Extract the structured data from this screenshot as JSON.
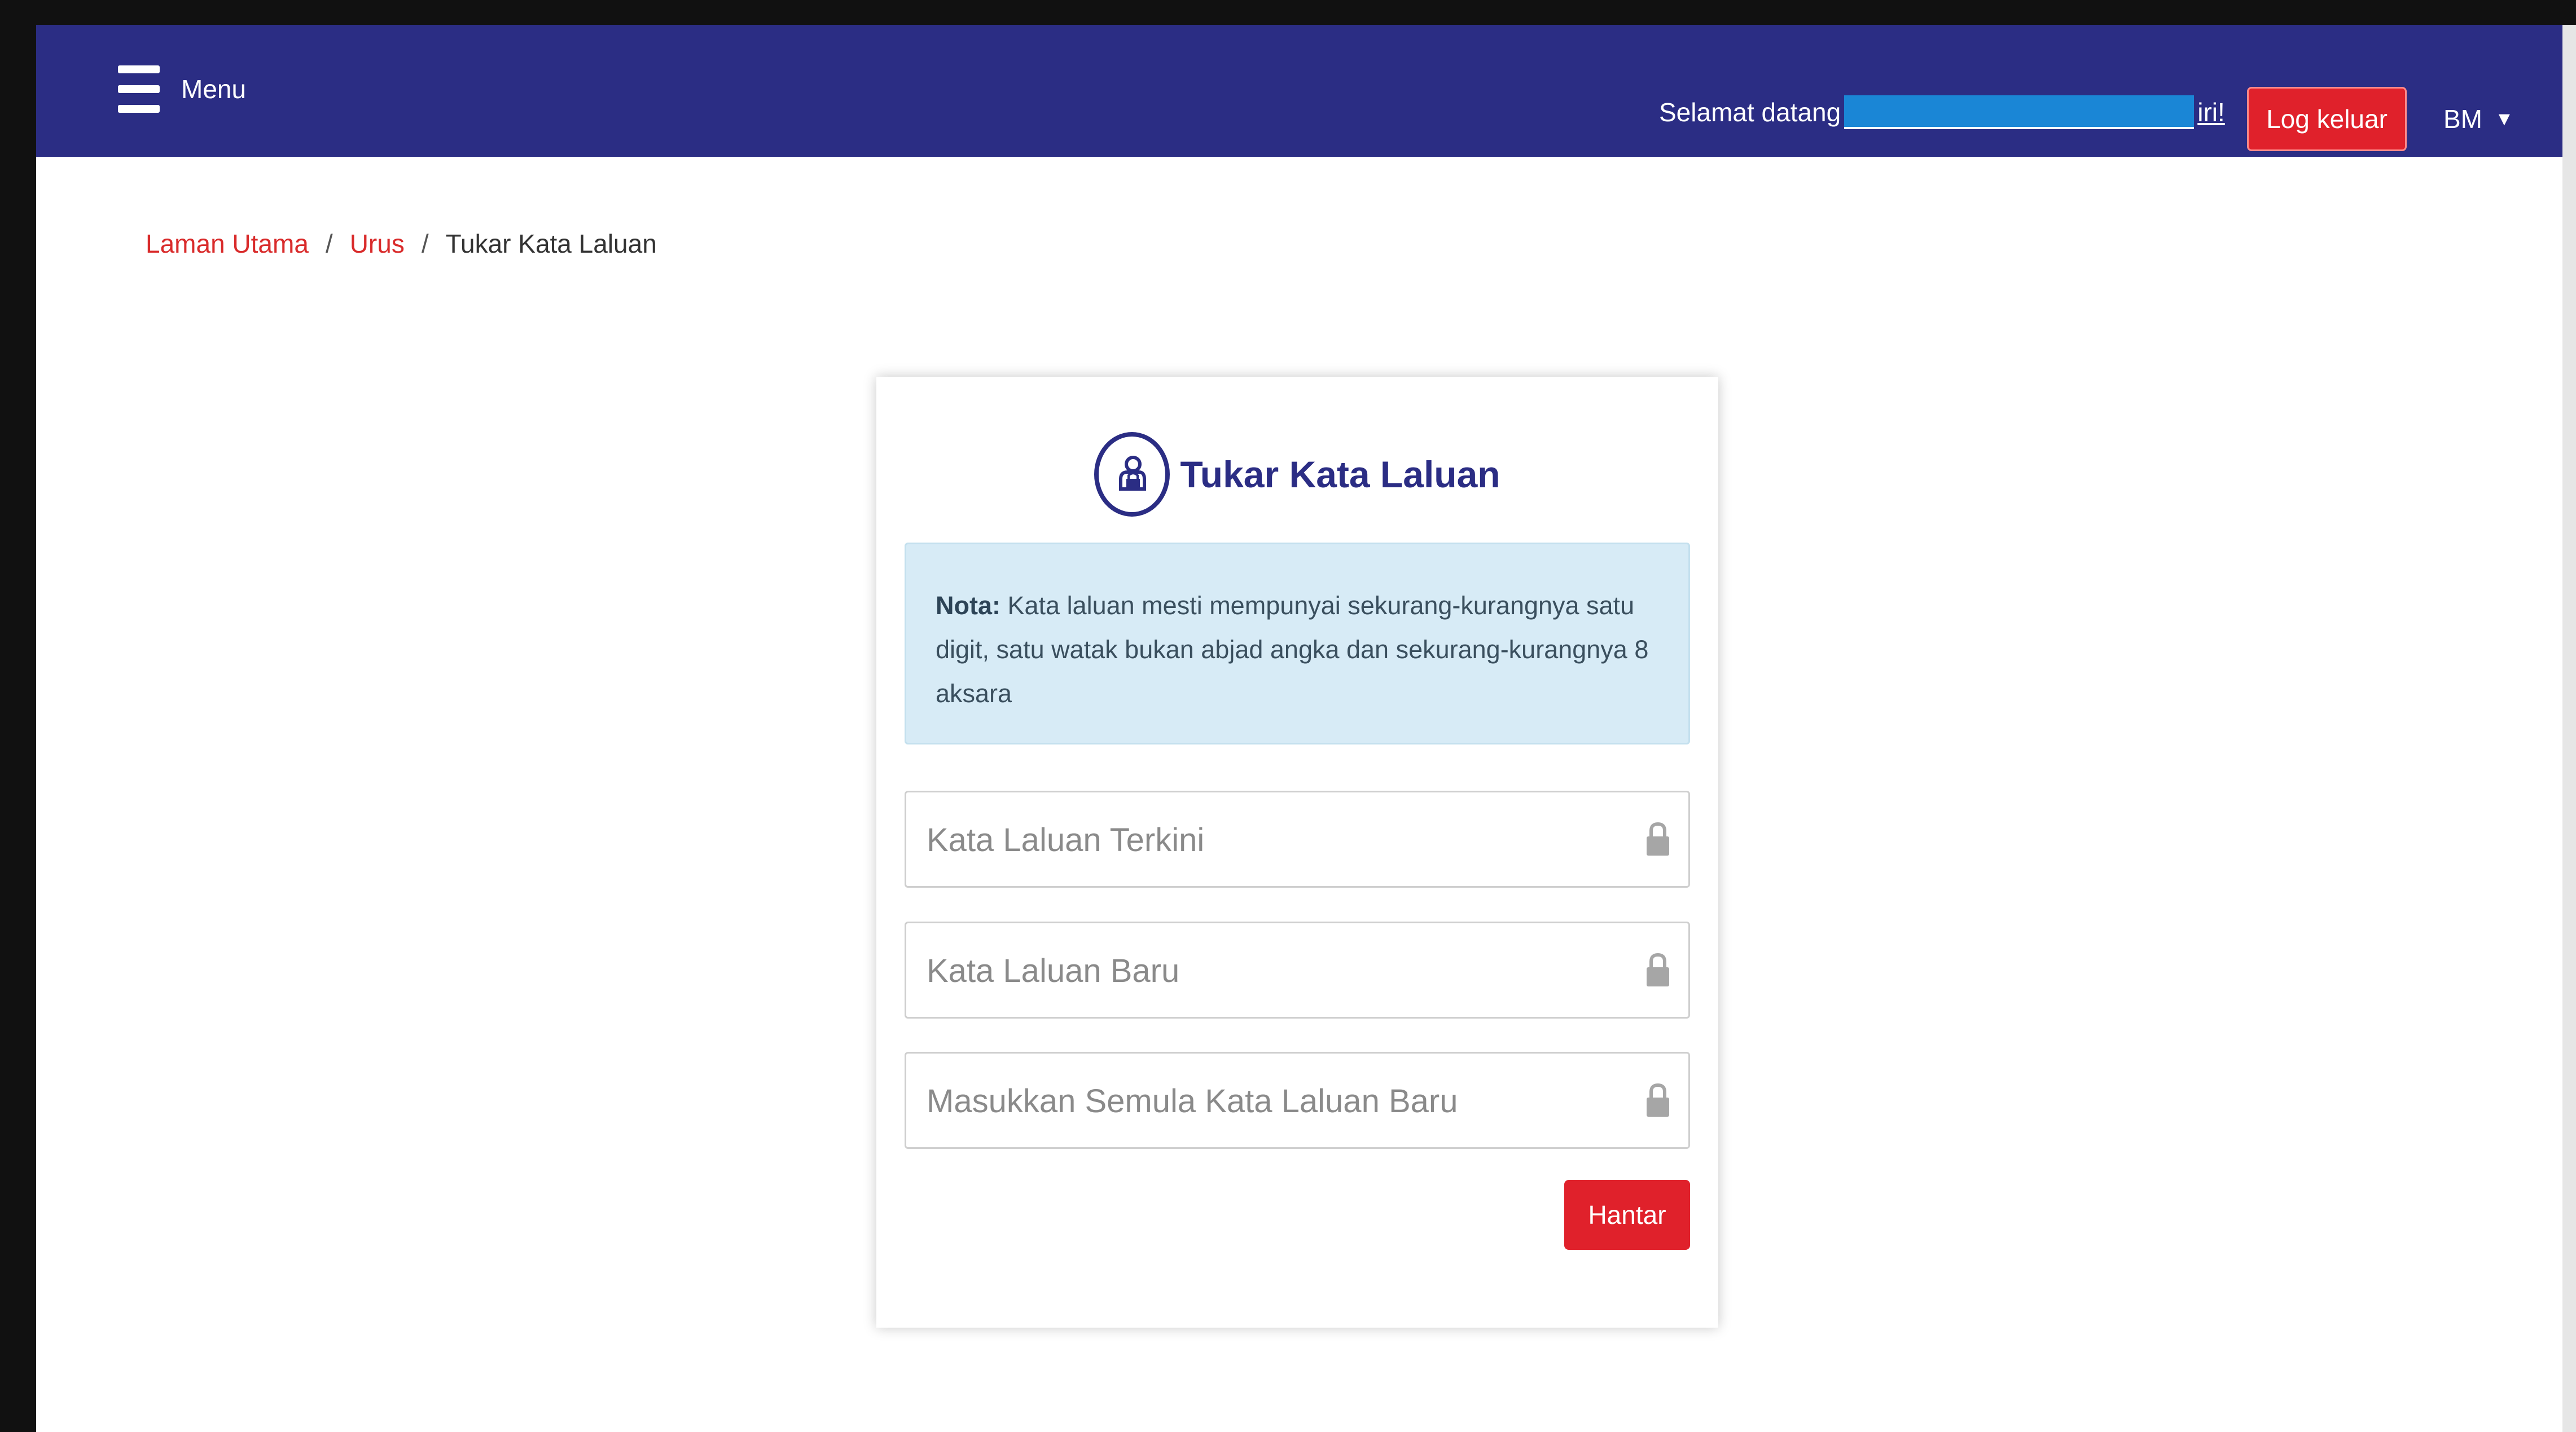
{
  "header": {
    "menu_label": "Menu",
    "welcome_prefix": "Selamat datang",
    "welcome_suffix": "iri!",
    "logout_label": "Log keluar",
    "language": "BM",
    "colors": {
      "navbar": "#2b2d84",
      "button": "#e0212b"
    },
    "icons": {
      "menu": "hamburger-icon",
      "language_caret": "caret-down-icon"
    }
  },
  "breadcrumb": {
    "items": [
      "Laman Utama",
      "Urus",
      "Tukar Kata Laluan"
    ],
    "separator": "/"
  },
  "form": {
    "title": "Tukar Kata Laluan",
    "title_icon": "password-person-icon",
    "note_label": "Nota:",
    "note_text": "Kata laluan mesti mempunyai sekurang-kurangnya satu digit, satu watak bukan abjad angka dan sekurang-kurangnya 8 aksara",
    "fields": [
      {
        "placeholder": "Kata Laluan Terkini",
        "value": "",
        "icon": "lock-icon"
      },
      {
        "placeholder": "Kata Laluan Baru",
        "value": "",
        "icon": "lock-icon"
      },
      {
        "placeholder": "Masukkan Semula Kata Laluan Baru",
        "value": "",
        "icon": "lock-icon"
      }
    ],
    "submit_label": "Hantar"
  }
}
